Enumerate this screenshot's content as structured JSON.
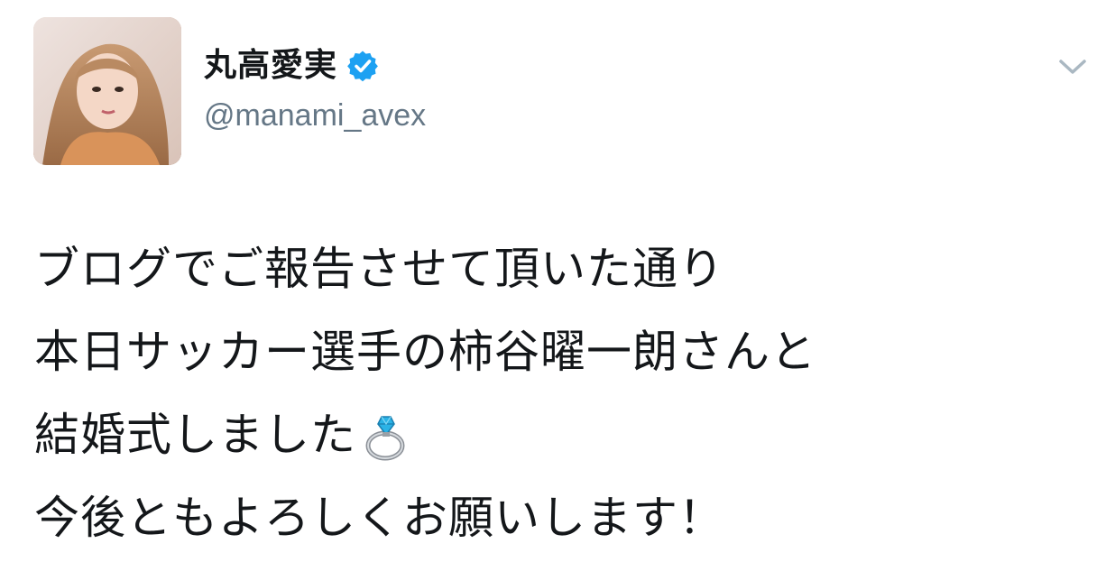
{
  "user": {
    "display_name": "丸高愛実",
    "handle": "@manami_avex",
    "verified": true,
    "verified_icon": "verified-badge-icon",
    "avatar_alt": "profile photo"
  },
  "menu": {
    "icon": "chevron-down-icon"
  },
  "tweet": {
    "lines": [
      "ブログでご報告させて頂いた通り",
      "本日サッカー選手の柿谷曜一朗さんと",
      "結婚式しました",
      "今後ともよろしくお願いします！"
    ],
    "emoji": "ring-emoji-icon"
  },
  "colors": {
    "verified_blue": "#1da1f2",
    "handle_gray": "#657786",
    "text": "#14171a",
    "caret_gray": "#aab8c2"
  }
}
